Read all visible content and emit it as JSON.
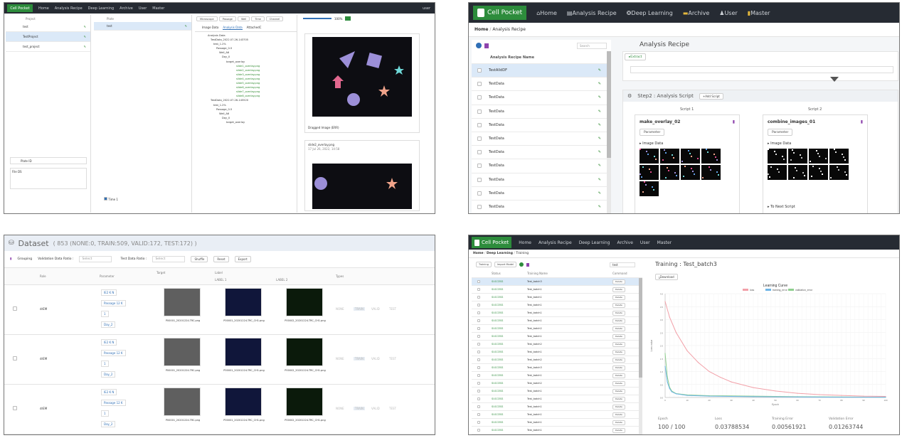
{
  "p1": {
    "nav": {
      "items": [
        "Home",
        "Analysis Recipe",
        "Deep Learning",
        "Archive",
        "User",
        "Master"
      ],
      "user": "user"
    },
    "col1_header": "Project",
    "col1_items": [
      "test",
      "TestProject",
      "test_project"
    ],
    "col2_header": "Plate",
    "col2_items": [
      "test"
    ],
    "col3_toolbar": [
      "Microscope",
      "Passage",
      "Well",
      "Time",
      "Channel"
    ],
    "tabs": [
      "Image Data",
      "Analysis Data",
      "AttachedC"
    ],
    "tree_lines": [
      "Analysis Data",
      "TestData_2022.07.26-143705",
      "test_1.2%",
      "Passage_0-5",
      "Well_A6",
      "Day_0",
      "target_overlay",
      "slide1_overlay.png",
      "slide2_overlay.png",
      "slide3_overlay.png",
      "slide4_overlay.png",
      "slide5_overlay.png",
      "slide6_overlay.png",
      "slide7_overlay.png",
      "slide8_overlay.png",
      "TestData_2022.07.26-145520",
      "test_1.2%",
      "Passage_0-5",
      "Well_A6",
      "Day_0",
      "target_overlay"
    ],
    "zoom": "100%",
    "footer_left": "Plate ID",
    "file_label": "File DS",
    "dragged_label": "Dragged Image (ERR)",
    "file2_name": "slide2_overlay.png",
    "file2_date": "17 Jul 26, 2022, 14:58",
    "tree_footer": "Time 1"
  },
  "p2": {
    "brand": "Cell Pocket",
    "nav": [
      "Home",
      "Analysis Recipe",
      "Deep Learning",
      "Archive",
      "User",
      "Master"
    ],
    "breadcrumb": [
      "Home",
      "Analysis Recipe"
    ],
    "search_placeholder": "Search",
    "list_header": "Analysis Recipe Name",
    "list_items": [
      "TestAlldDF",
      "TestData",
      "TestData",
      "TestData",
      "TestData",
      "TestData",
      "TestData",
      "TestData",
      "TestData",
      "TestData",
      "TestData"
    ],
    "title": "Analysis Recipe",
    "extract_label": "Extract",
    "step2_title": "Step2 : Analysis Script",
    "add_script": "Add Script",
    "script1_header": "Script 1",
    "script2_header": "Script 2",
    "script1_name": "make_overlay_02",
    "script2_name": "combine_images_01",
    "parameter": "Parameter",
    "image_data": "Image Data",
    "to_next": "To Next Script"
  },
  "p3": {
    "title": "Dataset",
    "summary": "( 853 (NONE:0, TRAIN:509, VALID:172, TEST:172) )",
    "toolbar": {
      "grouping": "Grouping",
      "val_ratio": "Validation Data Ratio :",
      "test_ratio": "Test Data Ratio :",
      "select": "Select",
      "shuffle": "Shuffle",
      "reset": "Reset",
      "export": "Export"
    },
    "cols": [
      "Role",
      "Parameter",
      "Target",
      "Label",
      "Types"
    ],
    "label_cols": [
      "LABEL 1",
      "LABEL 2"
    ],
    "rows": [
      {
        "role": "drEM",
        "params": [
          "IE2 K N",
          "Passage 12 K",
          "1",
          "Day_2"
        ],
        "files": [
          "P00001_20201224-TRC.png",
          "P00001_20201224-TRC_CH1.png",
          "P00002_20201224-TRC_CH1.png"
        ]
      },
      {
        "role": "drEM",
        "params": [
          "IE2 K N",
          "Passage 12 K",
          "1",
          "Day_2"
        ],
        "files": [
          "P00001_20201224-TRC.png",
          "P00001_20201224-TRC_CH1.png",
          "P00002_20201224-TRC_CH1.png"
        ]
      },
      {
        "role": "drEM",
        "params": [
          "IE2 K N",
          "Passage 12 K",
          "1",
          "Day_2"
        ],
        "files": [
          "P00001_20201224-TRC.png",
          "P00001_20201224-TRC_CH1.png",
          "P00002_20201224-TRC_CH1.png"
        ]
      }
    ],
    "types": [
      "NONE",
      "TRAIN",
      "VALID",
      "TEST"
    ]
  },
  "p4": {
    "brand": "Cell Pocket",
    "nav": [
      "Home",
      "Analysis Recipe",
      "Deep Learning",
      "Archive",
      "User",
      "Master"
    ],
    "breadcrumb": [
      "Home",
      "Deep Learning",
      "Training"
    ],
    "actions": [
      "Training",
      "Import Model"
    ],
    "search_placeholder": "test",
    "list_headers": [
      "Status",
      "Training Name",
      "Command"
    ],
    "list_rows": [
      {
        "status": "SUCCESS",
        "name": "Test_batch3",
        "cmd": "Delete"
      },
      {
        "status": "SUCCESS",
        "name": "Test_batch1",
        "cmd": "Delete"
      },
      {
        "status": "SUCCESS",
        "name": "Test_batch1",
        "cmd": "Delete"
      },
      {
        "status": "SUCCESS",
        "name": "Test_batch1",
        "cmd": "Delete"
      },
      {
        "status": "SUCCESS",
        "name": "Test_batch1",
        "cmd": "Delete"
      },
      {
        "status": "SUCCESS",
        "name": "Test_batch1",
        "cmd": "Delete"
      },
      {
        "status": "SUCCESS",
        "name": "Test_batch2",
        "cmd": "Delete"
      },
      {
        "status": "SUCCESS",
        "name": "Test_batch1",
        "cmd": "Delete"
      },
      {
        "status": "SUCCESS",
        "name": "Test_batch2",
        "cmd": "Delete"
      },
      {
        "status": "SUCCESS",
        "name": "Test_batch1",
        "cmd": "Delete"
      },
      {
        "status": "SUCCESS",
        "name": "Test_batch2",
        "cmd": "Delete"
      },
      {
        "status": "SUCCESS",
        "name": "Test_batch3",
        "cmd": "Delete"
      },
      {
        "status": "SUCCESS",
        "name": "Test_batch1",
        "cmd": "Delete"
      },
      {
        "status": "SUCCESS",
        "name": "Test_batch2",
        "cmd": "Delete"
      },
      {
        "status": "SUCCESS",
        "name": "Test_batch1",
        "cmd": "Delete"
      },
      {
        "status": "SUCCESS",
        "name": "Test_batch1",
        "cmd": "Delete"
      },
      {
        "status": "SUCCESS",
        "name": "Test_batch1",
        "cmd": "Delete"
      },
      {
        "status": "SUCCESS",
        "name": "Test_batch1",
        "cmd": "Delete"
      },
      {
        "status": "SUCCESS",
        "name": "Test_batch1",
        "cmd": "Delete"
      },
      {
        "status": "SUCCESS",
        "name": "Test_batch1",
        "cmd": "Delete"
      }
    ],
    "title": "Training : Test_batch3",
    "download": "Download",
    "stats": {
      "labels": [
        "Epoch",
        "Loss",
        "Training Error",
        "Validation Error"
      ],
      "values": [
        "100 / 100",
        "0.03788534",
        "0.00561921",
        "0.01263744"
      ]
    }
  },
  "chart_data": {
    "type": "line",
    "title": "Learning Curve",
    "ylabel": "Loss value",
    "xlabel": "Epoch",
    "xlim": [
      0,
      100
    ],
    "ylim": [
      0,
      4
    ],
    "series": [
      {
        "name": "loss",
        "color": "#f2a0a8",
        "x": [
          0,
          2,
          5,
          10,
          15,
          20,
          25,
          30,
          40,
          50,
          60,
          70,
          80,
          90,
          100
        ],
        "values": [
          3.7,
          3.1,
          2.5,
          1.8,
          1.35,
          1.0,
          0.78,
          0.6,
          0.38,
          0.25,
          0.16,
          0.11,
          0.08,
          0.05,
          0.04
        ]
      },
      {
        "name": "training_error",
        "color": "#6eb5e6",
        "x": [
          0,
          1,
          2,
          3,
          5,
          10,
          20,
          40,
          60,
          80,
          100
        ],
        "values": [
          1.2,
          0.6,
          0.35,
          0.22,
          0.14,
          0.08,
          0.05,
          0.03,
          0.02,
          0.01,
          0.01
        ]
      },
      {
        "name": "validation_error",
        "color": "#8fcf8f",
        "x": [
          0,
          1,
          2,
          3,
          5,
          10,
          20,
          40,
          60,
          80,
          100
        ],
        "values": [
          1.7,
          0.8,
          0.4,
          0.25,
          0.15,
          0.1,
          0.07,
          0.05,
          0.03,
          0.02,
          0.01
        ]
      }
    ]
  }
}
